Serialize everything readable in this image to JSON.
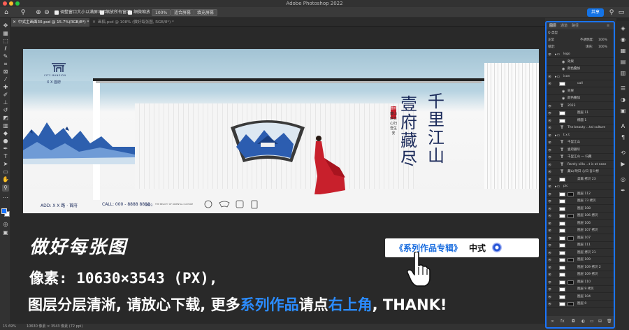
{
  "app": {
    "title": "Adobe Photoshop 2022"
  },
  "colors": {
    "accent": "#1a75ff",
    "share": "#1473e6",
    "navy": "#1b2a5a",
    "red": "#c8202c",
    "highlight": "#2b8cff"
  },
  "options_bar": {
    "checkbox1": "调整窗口大小以满屏显示",
    "checkbox2": "缩放所有窗口",
    "checkbox3": "细微缩放",
    "zoom_value": "100%",
    "fit_screen": "适合屏幕",
    "fill_screen": "填充屏幕",
    "share": "共享"
  },
  "tabs": [
    {
      "label": "中式主画面30.psd @ 15.7%(RGB/8*) *"
    },
    {
      "label": "画稿.psd @ 108% (微好每张图, RGB/8*) *"
    }
  ],
  "canvas": {
    "logo_sub": "CITY  MANSION",
    "logo_name": "X X 首府",
    "poem_col1": "千里江山",
    "poem_col2": "壹府藏尽",
    "seal": "壹府",
    "poem_small": "藏山 映日 心归 吾生安",
    "footer_add": "ADD: X X 路 · 首府",
    "footer_call": "CALL: 000 - 8888 8888",
    "footer_year": "2023",
    "footer_tag": "THE BEAUTY OF ORIENTAL CULTURE"
  },
  "overlay": {
    "title": "做好每张图",
    "line1": "像素: 10630×3543 (PX),",
    "line2_a": "图层分层清淅, 请放心下载, 更多",
    "line2_b": "系列作品",
    "line2_c": "请点",
    "line2_d": "右上角",
    "line2_e": ", THANK!",
    "callout_blue": "《系列作品专辑》",
    "callout_black": "中式"
  },
  "layers_panel": {
    "tabs": [
      "图层",
      "通道",
      "路径"
    ],
    "kind_filter": "Q 类型",
    "blend_mode": "正常",
    "opacity_label": "不透明度:",
    "opacity_value": "100%",
    "lock_label": "锁定:",
    "fill_label": "填充:",
    "fill_value": "100%",
    "layers": [
      {
        "name": "logo",
        "kind": "group"
      },
      {
        "name": "效果",
        "kind": "sub"
      },
      {
        "name": "颜色叠加",
        "kind": "sub"
      },
      {
        "name": "icon",
        "kind": "group"
      },
      {
        "name": "call",
        "kind": "layer"
      },
      {
        "name": "效果",
        "kind": "sub"
      },
      {
        "name": "颜色叠加",
        "kind": "sub"
      },
      {
        "name": "2023",
        "kind": "text"
      },
      {
        "name": "图层 11",
        "kind": "layer"
      },
      {
        "name": "椭圆 1",
        "kind": "layer"
      },
      {
        "name": "The beauty ...tal culture",
        "kind": "text"
      },
      {
        "name": "t x t",
        "kind": "group"
      },
      {
        "name": "千里江山",
        "kind": "text"
      },
      {
        "name": "壹府藏尽",
        "kind": "text"
      },
      {
        "name": "千里江山 一 归藏",
        "kind": "text"
      },
      {
        "name": "Rarely villa ...t is at ease",
        "kind": "text"
      },
      {
        "name": "藏山 映日 心归 吾少想",
        "kind": "text"
      },
      {
        "name": "美篇 拷贝 23",
        "kind": "layer"
      },
      {
        "name": "pic",
        "kind": "group"
      },
      {
        "name": "图层 112",
        "kind": "layer"
      },
      {
        "name": "图层 73 拷贝",
        "kind": "layer"
      },
      {
        "name": "图层 108",
        "kind": "layer"
      },
      {
        "name": "图层 106 拷贝",
        "kind": "layer"
      },
      {
        "name": "图层 106",
        "kind": "layer"
      },
      {
        "name": "图层 107 拷贝",
        "kind": "layer"
      },
      {
        "name": "图层 107",
        "kind": "layer"
      },
      {
        "name": "图层 111",
        "kind": "layer"
      },
      {
        "name": "图层 拷贝 21",
        "kind": "layer"
      },
      {
        "name": "图层 109",
        "kind": "layer"
      },
      {
        "name": "图层 109 拷贝 2",
        "kind": "layer"
      },
      {
        "name": "图层 109 拷贝",
        "kind": "layer"
      },
      {
        "name": "图层 110",
        "kind": "layer"
      },
      {
        "name": "图层 9 拷贝",
        "kind": "layer"
      },
      {
        "name": "图层 104",
        "kind": "layer"
      },
      {
        "name": "图层 0",
        "kind": "layer"
      }
    ]
  },
  "status": {
    "zoom": "15.69%",
    "size": "10630 像素 × 3543 像素 (72 ppi)"
  }
}
